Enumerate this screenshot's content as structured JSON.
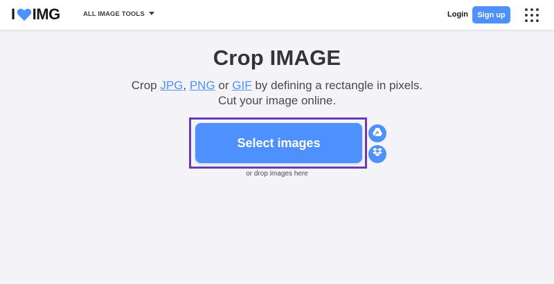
{
  "header": {
    "logo_text_left": "I",
    "logo_text_right": "IMG",
    "tools_menu_label": "ALL IMAGE TOOLS",
    "login_label": "Login",
    "signup_label": "Sign up"
  },
  "main": {
    "title": "Crop IMAGE",
    "subtitle_prefix": "Crop ",
    "format_links": [
      "JPG",
      "PNG",
      "GIF"
    ],
    "subtitle_sep1": ", ",
    "subtitle_sep2": " or ",
    "subtitle_suffix": " by defining a rectangle in pixels.",
    "subtitle_line2": "Cut your image online.",
    "select_button_label": "Select images",
    "drop_hint": "or drop images here"
  },
  "colors": {
    "accent": "#4d90fe",
    "highlight_border": "#6a3ab2",
    "background": "#f4f4f8"
  },
  "icons": [
    "heart-icon",
    "caret-down-icon",
    "apps-grid-icon",
    "google-drive-icon",
    "dropbox-icon"
  ]
}
